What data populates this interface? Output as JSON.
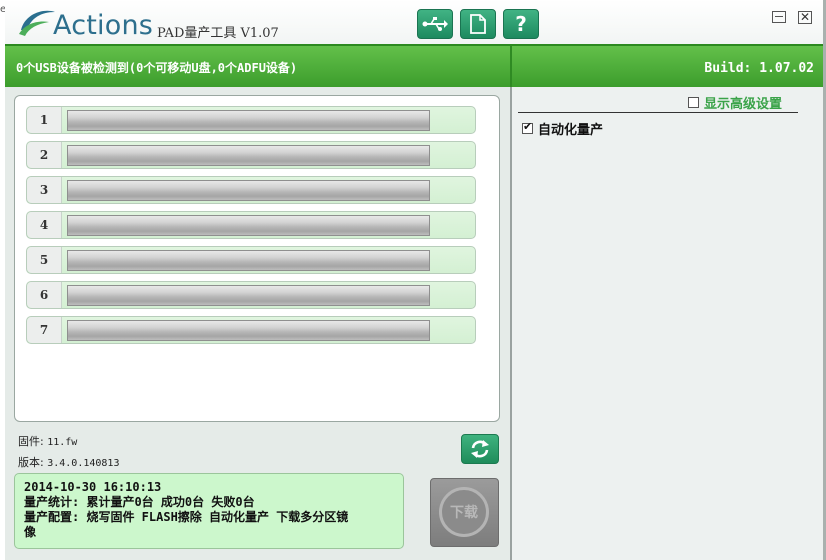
{
  "app": {
    "logo_text": "Actions",
    "title": "PAD量产工具 V1.07",
    "edge_char": "e"
  },
  "toolbar": {
    "usb_icon": "usb-icon",
    "file_icon": "document-icon",
    "help_label": "?"
  },
  "status": {
    "device_count": "0个USB设备被检测到(0个可移动U盘,0个ADFU设备)",
    "build": "Build: 1.07.02"
  },
  "ports": [
    {
      "num": "1",
      "progress": 0
    },
    {
      "num": "2",
      "progress": 0
    },
    {
      "num": "3",
      "progress": 0
    },
    {
      "num": "4",
      "progress": 0
    },
    {
      "num": "5",
      "progress": 0
    },
    {
      "num": "6",
      "progress": 0
    },
    {
      "num": "7",
      "progress": 0
    }
  ],
  "firmware": {
    "label": "固件:",
    "value": "11.fw",
    "version_label": "版本:",
    "version_value": "3.4.0.140813"
  },
  "log": {
    "line1": "2014-10-30 16:10:13",
    "line2": "量产统计: 累计量产0台 成功0台 失败0台",
    "line3": "量产配置: 烧写固件 FLASH擦除 自动化量产 下载多分区镜",
    "line4": "像"
  },
  "download_label": "下载",
  "settings": {
    "advanced_label": "显示高级设置",
    "advanced_checked": false,
    "auto_label": "自动化量产",
    "auto_checked": true
  }
}
